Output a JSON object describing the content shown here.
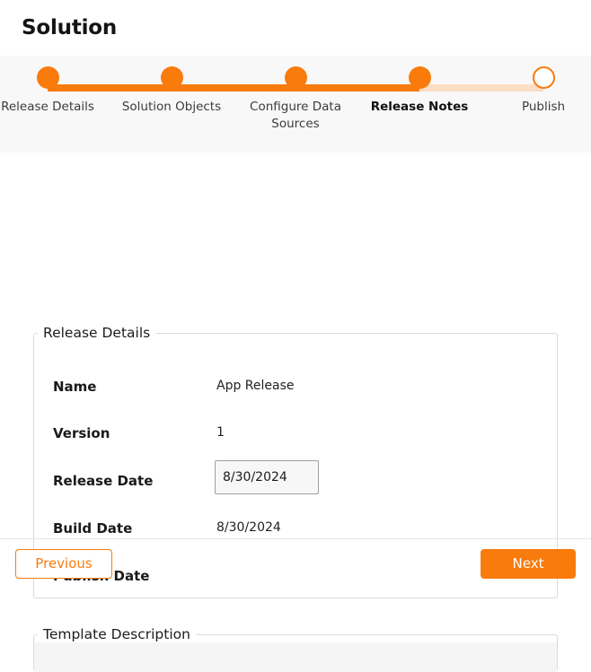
{
  "header": {
    "title": "Solution"
  },
  "stepper": {
    "steps": [
      {
        "label": "Release Details",
        "state": "complete",
        "active": false
      },
      {
        "label": "Solution Objects",
        "state": "complete",
        "active": false
      },
      {
        "label": "Configure Data Sources",
        "state": "complete",
        "active": false
      },
      {
        "label": "Release Notes",
        "state": "complete",
        "active": true
      },
      {
        "label": "Publish",
        "state": "upcoming",
        "active": false
      }
    ],
    "colors": {
      "complete": "#f97b0c",
      "upcoming_line": "#fbddc4",
      "upcoming_dot_fill": "#ffffff",
      "band_background": "#f8f8f8"
    }
  },
  "release_details": {
    "legend": "Release Details",
    "fields": [
      {
        "label": "Name",
        "value": "App Release",
        "type": "text"
      },
      {
        "label": "Version",
        "value": "1",
        "type": "text"
      },
      {
        "label": "Release Date",
        "value": "8/30/2024",
        "type": "input"
      },
      {
        "label": "Build Date",
        "value": "8/30/2024",
        "type": "text"
      },
      {
        "label": "Publish Date",
        "value": "",
        "type": "text"
      }
    ]
  },
  "template_description": {
    "legend": "Template Description",
    "value": "",
    "placeholder": ""
  },
  "footer": {
    "previous_label": "Previous",
    "next_label": "Next",
    "accent": "#f97b0c"
  }
}
